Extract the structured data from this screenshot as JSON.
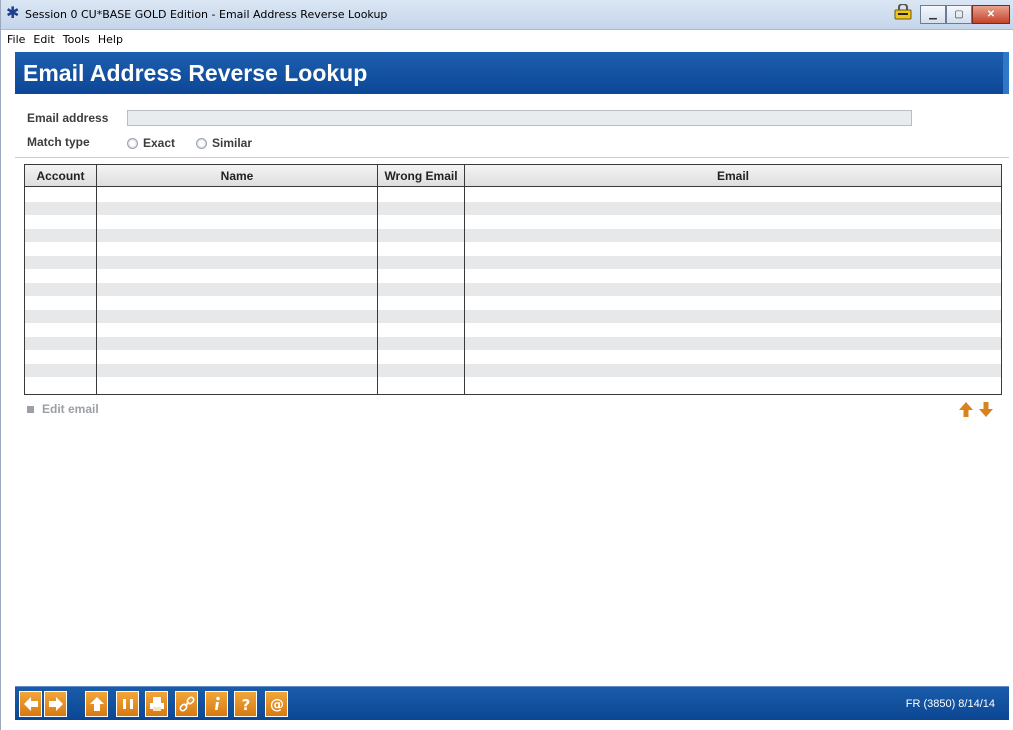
{
  "window": {
    "title": "Session 0 CU*BASE GOLD Edition - Email Address Reverse Lookup"
  },
  "menu": [
    "File",
    "Edit",
    "Tools",
    "Help"
  ],
  "page": {
    "title": "Email Address Reverse Lookup"
  },
  "form": {
    "email_label": "Email address",
    "email_value": "",
    "match_type_label": "Match type",
    "match_options": [
      "Exact",
      "Similar"
    ]
  },
  "table": {
    "columns": [
      "Account",
      "Name",
      "Wrong Email",
      "Email"
    ],
    "rows": []
  },
  "actions": {
    "edit_email": "Edit email"
  },
  "footer": {
    "status": "FR (3850) 8/14/14",
    "buttons": [
      "back-arrow-icon",
      "forward-arrow-icon",
      "up-arrow-icon",
      "pause-icon",
      "print-icon",
      "link-icon",
      "info-icon",
      "help-icon",
      "email-icon"
    ]
  },
  "colors": {
    "header_blue": "#0c4796",
    "button_orange": "#e58a1f",
    "arrow_orange": "#d9831f"
  }
}
